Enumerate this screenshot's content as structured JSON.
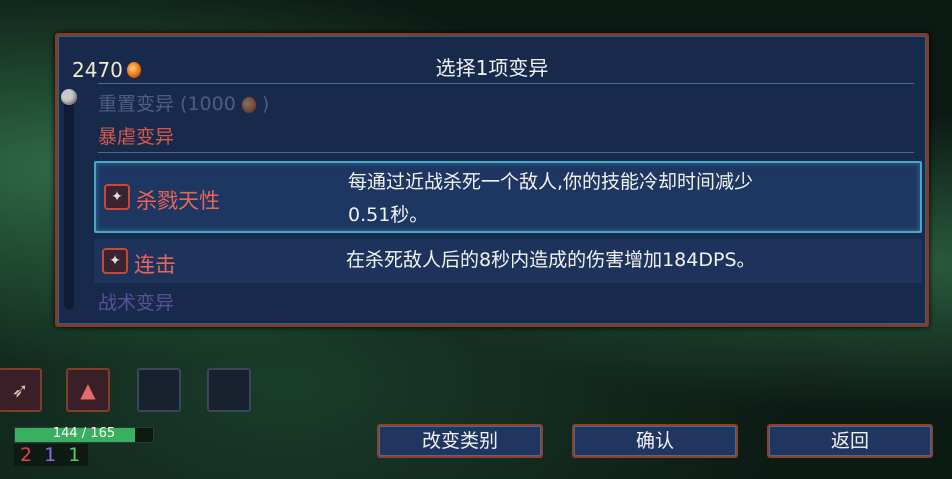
{
  "header": {
    "gold": "2470",
    "title": "选择1项变异"
  },
  "reroll_label": "重置变异 (1000",
  "sections": {
    "brutality": "暴虐变异",
    "tactics": "战术变异"
  },
  "mutations": [
    {
      "name": "杀戮天性",
      "icon": "blade-icon",
      "desc_line1": "每通过近战杀死一个敌人,你的技能冷却时间减少",
      "desc_line2": "0.51秒。",
      "selected": true
    },
    {
      "name": "连击",
      "icon": "combo-icon",
      "desc_line1": "在杀死敌人后的8秒内造成的伤害增加184DPS。",
      "desc_line2": "",
      "selected": false
    }
  ],
  "player": {
    "hp_text": "144 / 165",
    "hp_fraction": 0.873,
    "stat_brutality": "2",
    "stat_tactics": "1",
    "stat_survival": "1"
  },
  "buttons": {
    "change_category": "改变类别",
    "confirm": "确认",
    "back": "返回"
  },
  "colors": {
    "brutality": "#e96655",
    "tactics": "#8f6fe0",
    "survival": "#4fd16a"
  }
}
